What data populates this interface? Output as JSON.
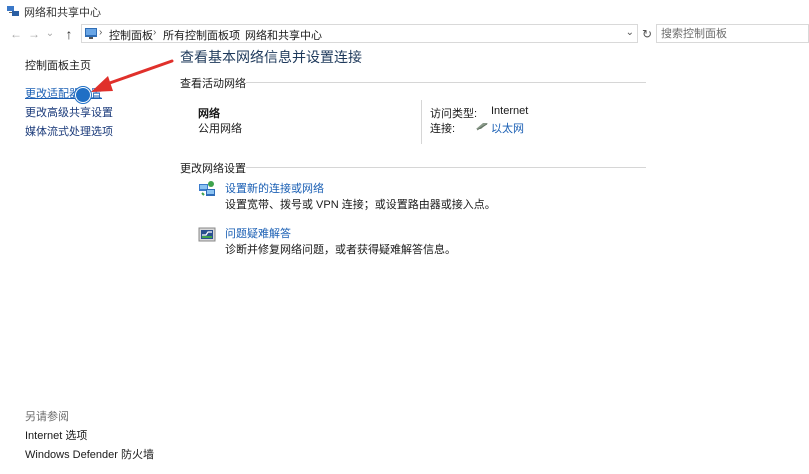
{
  "window": {
    "title": "网络和共享中心"
  },
  "address_bar": {
    "back": "←",
    "forward": "→",
    "recent": "⌄",
    "up": "↑",
    "breadcrumbs": [
      "控制面板",
      "所有控制面板项",
      "网络和共享中心"
    ],
    "dropdown": "⌄",
    "refresh": "↻",
    "search_placeholder": "搜索控制面板"
  },
  "sidebar": {
    "home": "控制面板主页",
    "links": [
      "更改适配器设置",
      "更改高级共享设置",
      "媒体流式处理选项"
    ],
    "see_also_title": "另请参阅",
    "see_also": [
      "Internet 选项",
      "Windows Defender 防火墙"
    ]
  },
  "main": {
    "title": "查看基本网络信息并设置连接",
    "active_networks": {
      "heading": "查看活动网络",
      "network_name": "网络",
      "network_type": "公用网络",
      "access_type_label": "访问类型:",
      "access_type_value": "Internet",
      "connections_label": "连接:",
      "connection_name": "以太网"
    },
    "change_settings": {
      "heading": "更改网络设置",
      "items": [
        {
          "title": "设置新的连接或网络",
          "desc": "设置宽带、拨号或 VPN 连接；或设置路由器或接入点。",
          "icon": "network-setup-icon"
        },
        {
          "title": "问题疑难解答",
          "desc": "诊断并修复网络问题，或者获得疑难解答信息。",
          "icon": "troubleshoot-icon"
        }
      ]
    }
  },
  "colors": {
    "link": "#1a5fb4",
    "title": "#1e395b",
    "arrow": "#e0302b"
  }
}
